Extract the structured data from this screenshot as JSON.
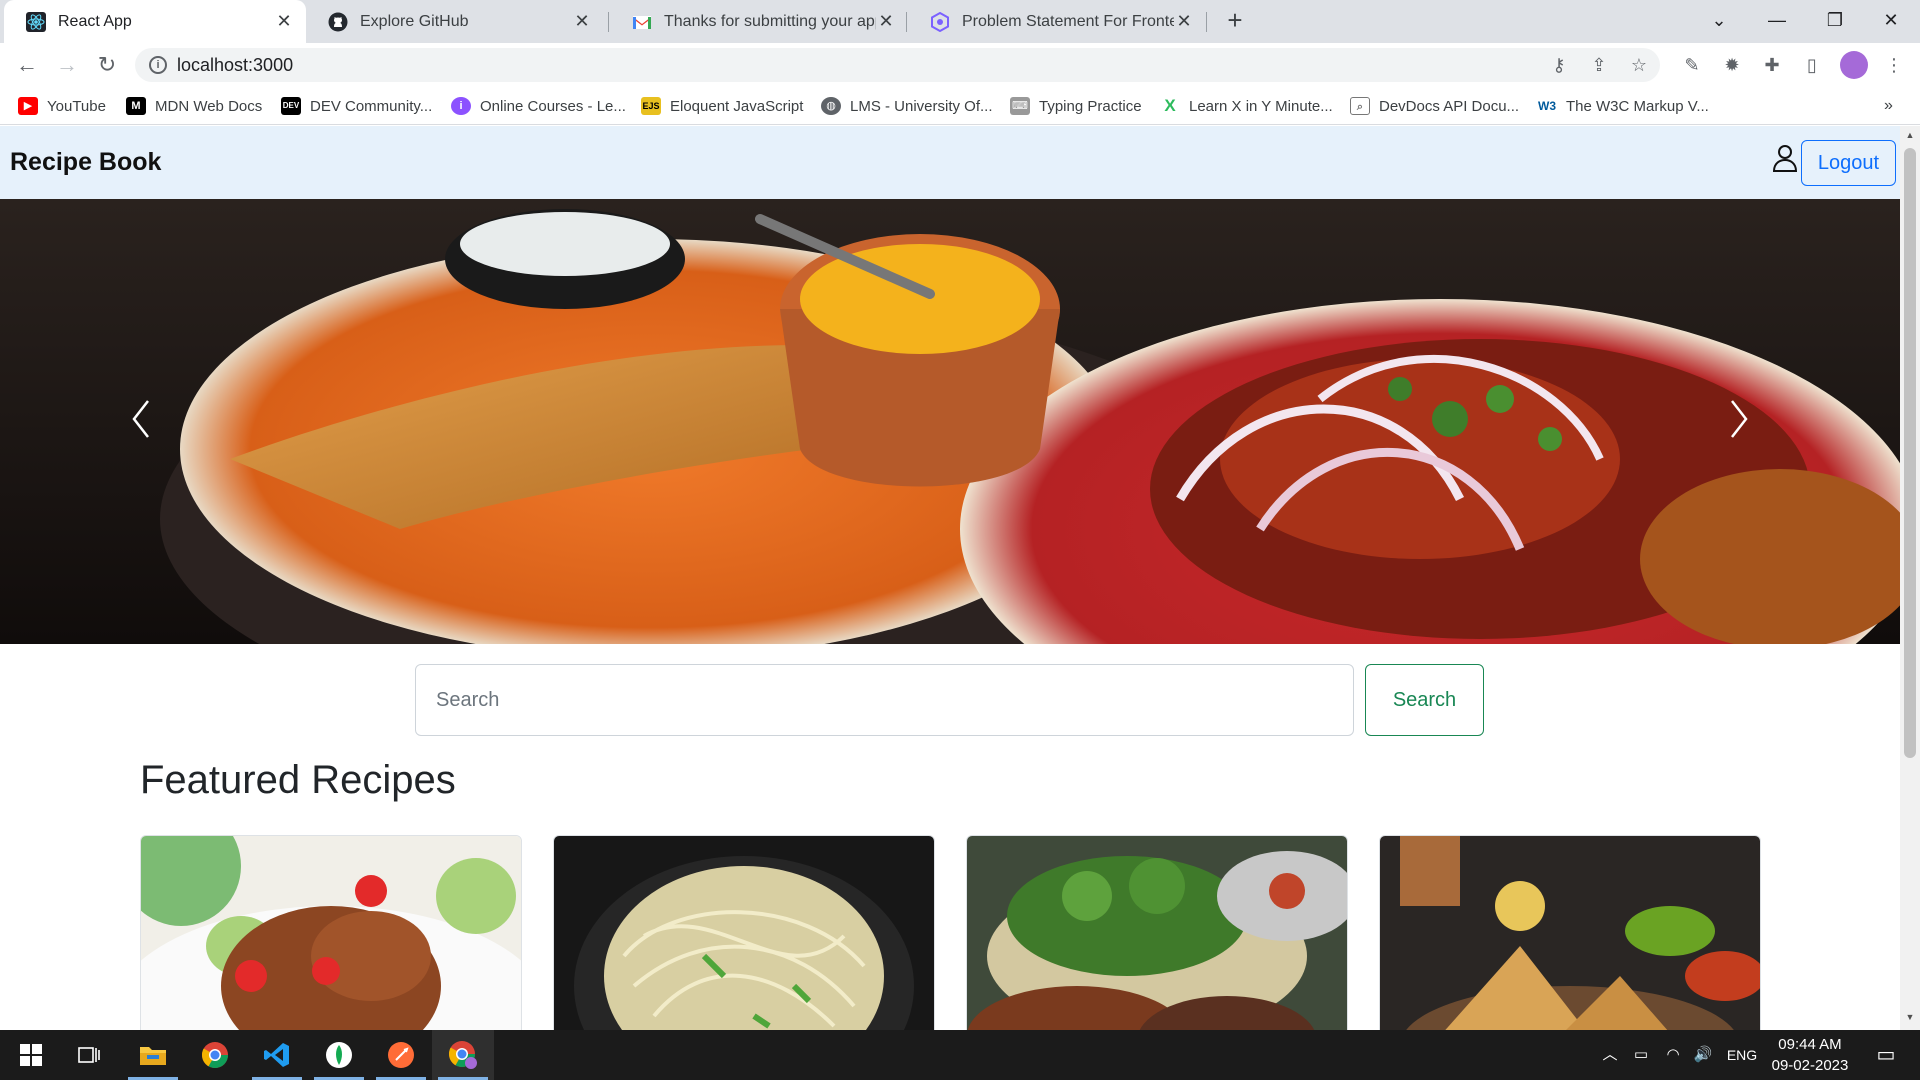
{
  "browser": {
    "tabs": [
      {
        "title": "React App",
        "icon": "react-icon",
        "active": true
      },
      {
        "title": "Explore GitHub",
        "icon": "github-icon",
        "active": false
      },
      {
        "title": "Thanks for submitting your appli",
        "icon": "gmail-icon",
        "active": false
      },
      {
        "title": "Problem Statement For Frontend",
        "icon": "problem-statement-icon",
        "active": false
      }
    ],
    "url": "localhost:3000",
    "bookmarks": [
      {
        "label": "YouTube",
        "icon": "youtube-icon",
        "color": "#ff0000"
      },
      {
        "label": "MDN Web Docs",
        "icon": "mdn-icon",
        "color": "#000000"
      },
      {
        "label": "DEV Community...",
        "icon": "dev-icon",
        "color": "#000000"
      },
      {
        "label": "Online Courses - Le...",
        "icon": "courses-icon",
        "color": "#8c52ff"
      },
      {
        "label": "Eloquent JavaScript",
        "icon": "ejs-icon",
        "color": "#e8c020"
      },
      {
        "label": "LMS - University Of...",
        "icon": "globe-icon",
        "color": "#5f6368"
      },
      {
        "label": "Typing Practice",
        "icon": "typing-icon",
        "color": "#777777"
      },
      {
        "label": "Learn X in Y Minute...",
        "icon": "learnx-icon",
        "color": "#2dbb5d"
      },
      {
        "label": "DevDocs API Docu...",
        "icon": "devdocs-icon",
        "color": "#777777"
      },
      {
        "label": "The W3C Markup V...",
        "icon": "w3c-icon",
        "color": "#005a9c"
      }
    ]
  },
  "app": {
    "brand": "Recipe Book",
    "logout_label": "Logout",
    "search": {
      "placeholder": "Search",
      "button_label": "Search"
    },
    "featured_heading": "Featured Recipes",
    "featured_cards": [
      {
        "image": "spicy-chicken-dish"
      },
      {
        "image": "hakka-noodles"
      },
      {
        "image": "grilled-chicken-salad"
      },
      {
        "image": "samosa-with-chutneys"
      }
    ],
    "colors": {
      "navbar_bg": "#e6f1fb",
      "logout": "#0d6efd",
      "search_btn": "#198754"
    }
  },
  "taskbar": {
    "apps": [
      "windows-start-icon",
      "task-view-icon",
      "file-explorer-icon",
      "chrome-icon",
      "vscode-icon",
      "mongodb-compass-icon",
      "postman-icon",
      "chrome-profile-icon"
    ],
    "language": "ENG",
    "time": "09:44 AM",
    "date": "09-02-2023"
  }
}
